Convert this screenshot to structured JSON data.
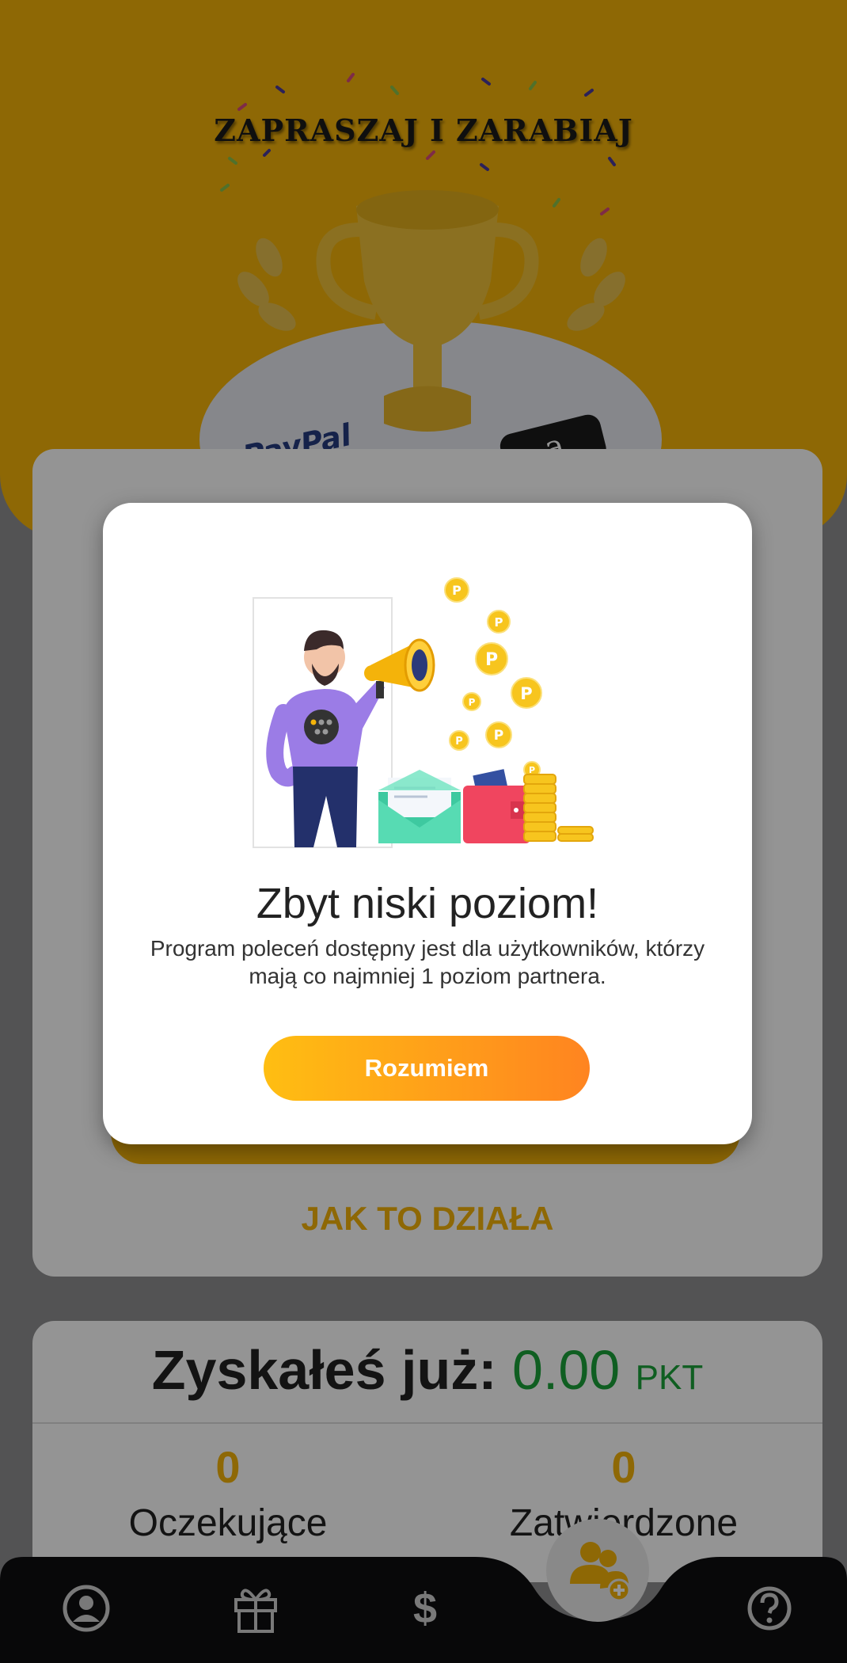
{
  "hero": {
    "title": "ZAPRASZAJ I ZARABIAJ",
    "paypal_logo": "PayPal",
    "amazon_logo": "a"
  },
  "main_card": {
    "how_it_works_label": "JAK TO DZIAŁA"
  },
  "stats": {
    "earned_label": "Zyskałeś już:",
    "earned_amount": "0.00",
    "earned_unit": "PKT",
    "pending_count": "0",
    "pending_label": "Oczekujące",
    "confirmed_count": "0",
    "confirmed_label": "Zatwierdzone"
  },
  "modal": {
    "title": "Zbyt niski poziom!",
    "message": "Program poleceń dostępny jest dla użytkowników, którzy mają co najmniej 1 poziom partnera.",
    "button_label": "Rozumiem",
    "coin_letter": "P"
  },
  "bottom_nav": {
    "items": [
      {
        "icon": "profile-icon"
      },
      {
        "icon": "gift-icon"
      },
      {
        "icon": "dollar-icon"
      },
      {
        "icon": "invite-friends-icon",
        "active": true
      },
      {
        "icon": "help-icon"
      }
    ],
    "dollar_symbol": "$"
  },
  "colors": {
    "accent": "#f4b30a",
    "success": "#1aa33a",
    "button_start": "#ffbe12",
    "button_end": "#ff8420",
    "nav_bg": "#0f0f10"
  }
}
